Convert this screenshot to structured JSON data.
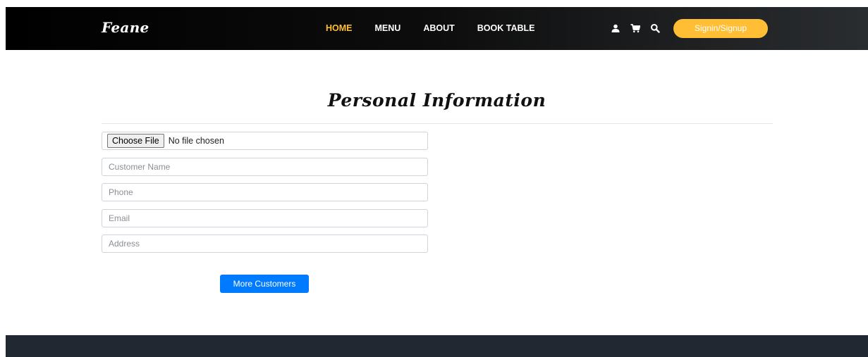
{
  "header": {
    "brand": "Feane",
    "nav": [
      {
        "label": "HOME",
        "active": true
      },
      {
        "label": "MENU",
        "active": false
      },
      {
        "label": "ABOUT",
        "active": false
      },
      {
        "label": "BOOK TABLE",
        "active": false
      }
    ],
    "icons": [
      "user-icon",
      "cart-icon",
      "search-icon"
    ],
    "signin_label": "Signin/Signup"
  },
  "main": {
    "title": "Personal Information",
    "file_input": {
      "button_label": "Choose File",
      "status": "No file chosen"
    },
    "fields": {
      "customer_name": {
        "placeholder": "Customer Name",
        "value": ""
      },
      "phone": {
        "placeholder": "Phone",
        "value": ""
      },
      "email": {
        "placeholder": "Email",
        "value": ""
      },
      "address": {
        "placeholder": "Address",
        "value": ""
      }
    },
    "more_button_label": "More Customers"
  },
  "colors": {
    "accent": "#ffbe33",
    "primary_button": "#007bff",
    "header_bg": "#000000",
    "footer_bg": "#222831"
  }
}
